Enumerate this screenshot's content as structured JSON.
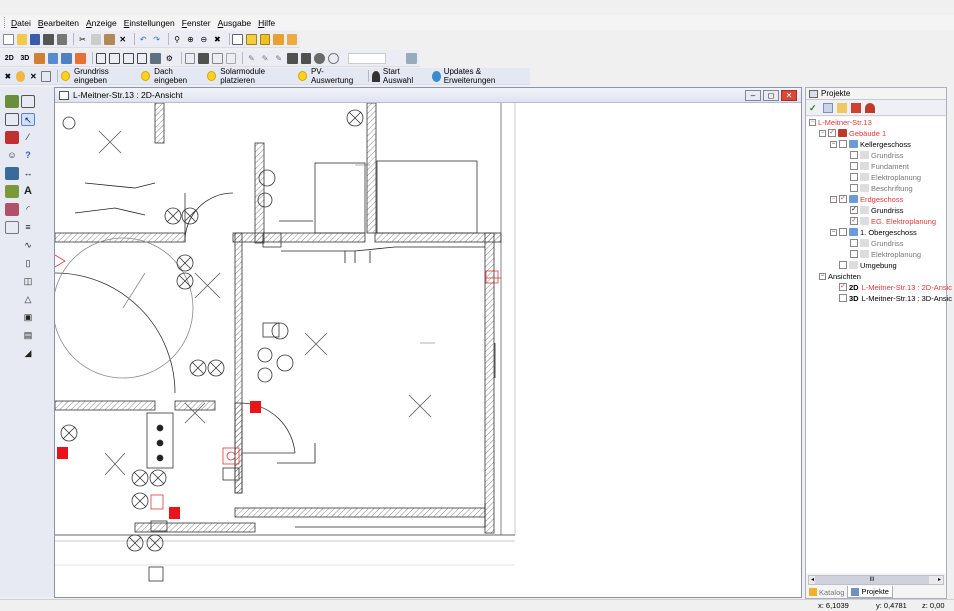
{
  "menu": [
    "Datei",
    "Bearbeiten",
    "Anzeige",
    "Einstellungen",
    "Fenster",
    "Ausgabe",
    "Hilfe"
  ],
  "toolbar2": {
    "view2d": "2D",
    "view3d": "3D"
  },
  "actions": {
    "grundriss": "Grundriss eingeben",
    "dach": "Dach eingeben",
    "solar": "Solarmodule platzieren",
    "pv": "PV-Auswertung",
    "start": "Start Auswahl",
    "updates": "Updates & Erweiterungen"
  },
  "document": {
    "title": "L-Meitner-Str.13 : 2D-Ansicht",
    "min": "–",
    "restore": "◻",
    "close": "✕"
  },
  "projects": {
    "header": "Projekte",
    "tree": {
      "root": "L-Meitner-Str.13",
      "building": "Gebäude 1",
      "keller": "Kellergeschoss",
      "keller_items": [
        "Grundriss",
        "Fundament",
        "Elektroplanung",
        "Beschriftung"
      ],
      "erd": "Erdgeschoss",
      "erd_items": [
        "Grundriss",
        "EG. Elektroplanung"
      ],
      "og": "1. Obergeschoss",
      "og_items": [
        "Grundriss",
        "Elektroplanung"
      ],
      "umgebung": "Umgebung",
      "ansichten": "Ansichten",
      "view2d_tag": "2D",
      "view2d": "L-Meitner-Str.13 : 2D-Ansic",
      "view3d_tag": "3D",
      "view3d": "L-Meitner-Str.13 : 3D-Ansic"
    },
    "tabs": [
      "Katalog",
      "Projekte"
    ],
    "scroll_mark": "III"
  },
  "status": {
    "x": "x: 6,1039",
    "y": "y: 0,4781",
    "z": "z: 0,00"
  },
  "colors": {
    "accent_red": "#e0393a",
    "bulb": "#ffd21e"
  }
}
